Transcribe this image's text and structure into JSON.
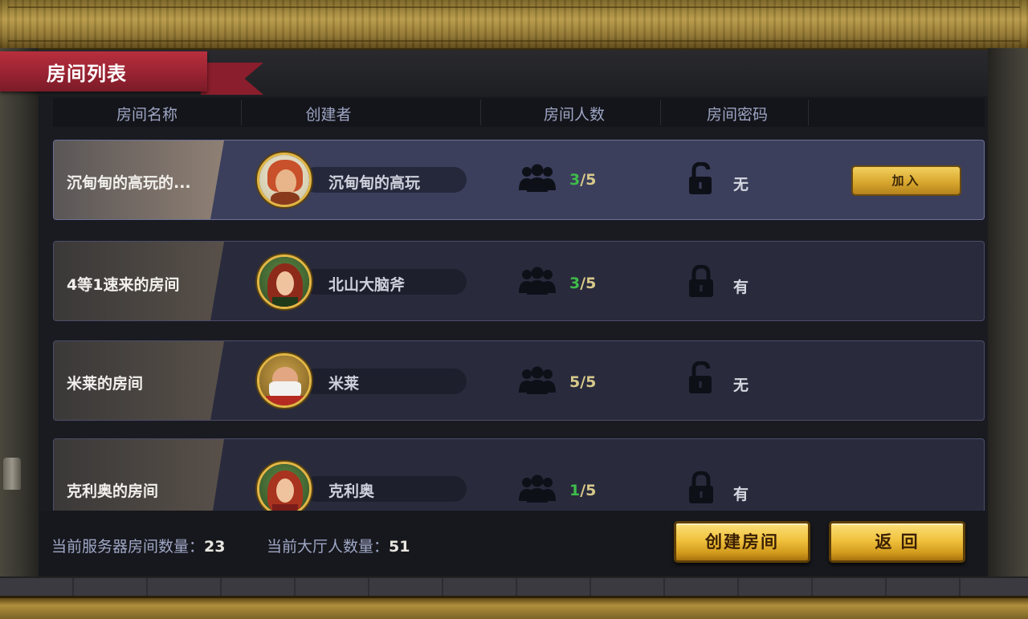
{
  "title": "房间列表",
  "columns": [
    "房间名称",
    "创建者",
    "房间人数",
    "房间密码"
  ],
  "rooms": [
    {
      "name": "沉甸甸的高玩的...",
      "creator": "沉甸甸的高玩",
      "current": "3",
      "max": "/5",
      "current_color": "green",
      "locked": false,
      "password": "无",
      "selected": true,
      "join_label": "加入"
    },
    {
      "name": "4等1速来的房间",
      "creator": "北山大脑斧",
      "current": "3",
      "max": "/5",
      "current_color": "green",
      "locked": true,
      "password": "有",
      "selected": false
    },
    {
      "name": "米莱的房间",
      "creator": "米莱",
      "current": "5",
      "max": "/5",
      "current_color": "gold",
      "locked": false,
      "password": "无",
      "selected": false
    },
    {
      "name": "克利奥的房间",
      "creator": "克利奥",
      "current": "1",
      "max": "/5",
      "current_color": "green",
      "locked": true,
      "password": "有",
      "selected": false
    }
  ],
  "footer": {
    "server_rooms_label": "当前服务器房间数量：",
    "server_rooms_value": "23",
    "lobby_players_label": "当前大厅人数量：",
    "lobby_players_value": "51",
    "create_label": "创建房间",
    "back_label": "返 回"
  },
  "colors": {
    "accent_gold": "#f0c23d",
    "ribbon_red": "#962231",
    "count_green": "#3fbb4a",
    "count_gold": "#d8c98a",
    "row_bg": "#292b3d",
    "row_selected_bg": "#3b3f5c"
  },
  "icons": {
    "people": "people-group-icon",
    "unlocked": "padlock-open-icon",
    "locked": "padlock-closed-icon"
  }
}
